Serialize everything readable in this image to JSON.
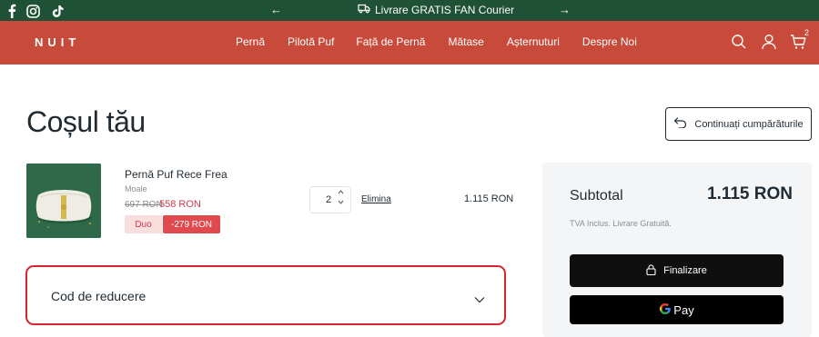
{
  "announcement": {
    "text": "Livrare GRATIS FAN Courier",
    "prev_arrow": "←",
    "next_arrow": "→",
    "icon": "truck-icon"
  },
  "social": [
    "facebook-icon",
    "instagram-icon",
    "tiktok-icon"
  ],
  "header": {
    "logo": "NUIT",
    "nav": [
      {
        "label": "Pernă"
      },
      {
        "label": "Pilotă Puf"
      },
      {
        "label": "Față de Pernă"
      },
      {
        "label": "Mătase"
      },
      {
        "label": "Așternuturi"
      },
      {
        "label": "Despre Noi"
      }
    ],
    "cart_count": "2",
    "icons": [
      "search-icon",
      "user-icon",
      "cart-icon"
    ]
  },
  "page": {
    "title": "Coșul tău",
    "continue_label": "Continuați cumpărăturile"
  },
  "item": {
    "name": "Pernă Puf Rece Frea",
    "variant": "Moale",
    "old_price": "697 RON",
    "new_price": "558 RON",
    "badge_bundle": "Duo",
    "badge_discount": "-279 RON",
    "quantity": "2",
    "remove_label": "Elimina",
    "line_total": "1.115 RON"
  },
  "discount": {
    "label": "Cod de reducere"
  },
  "summary": {
    "subtotal_label": "Subtotal",
    "subtotal_value": "1.115 RON",
    "note": "TVA Inclus. Livrare Gratuită.",
    "checkout_label": "Finalizare",
    "gpay_label": "Pay"
  },
  "colors": {
    "announcement_bg": "#1f5136",
    "header_bg": "#c84a3a",
    "sale_red": "#e04a4f",
    "highlight_border": "#d9232d"
  }
}
